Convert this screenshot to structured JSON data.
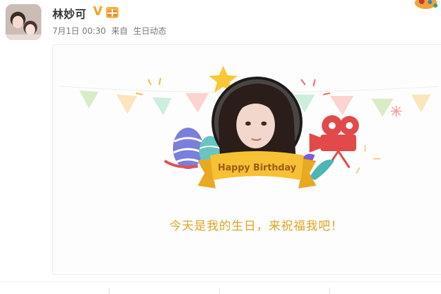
{
  "post": {
    "username": "林妙可",
    "verified_icon": "v-badge-icon",
    "vip_icon": "vip-badge-icon",
    "date": "7月1日 00:30",
    "source_prefix": "来自",
    "source": "生日动态"
  },
  "card": {
    "banner_text": "Happy Birthday",
    "wish": "今天是我的生日，来祝福我吧！",
    "colors": {
      "ribbon": "#f6c133",
      "ribbon_text": "#a0581a",
      "wish": "#e0a320",
      "star": "#f7c934"
    }
  }
}
